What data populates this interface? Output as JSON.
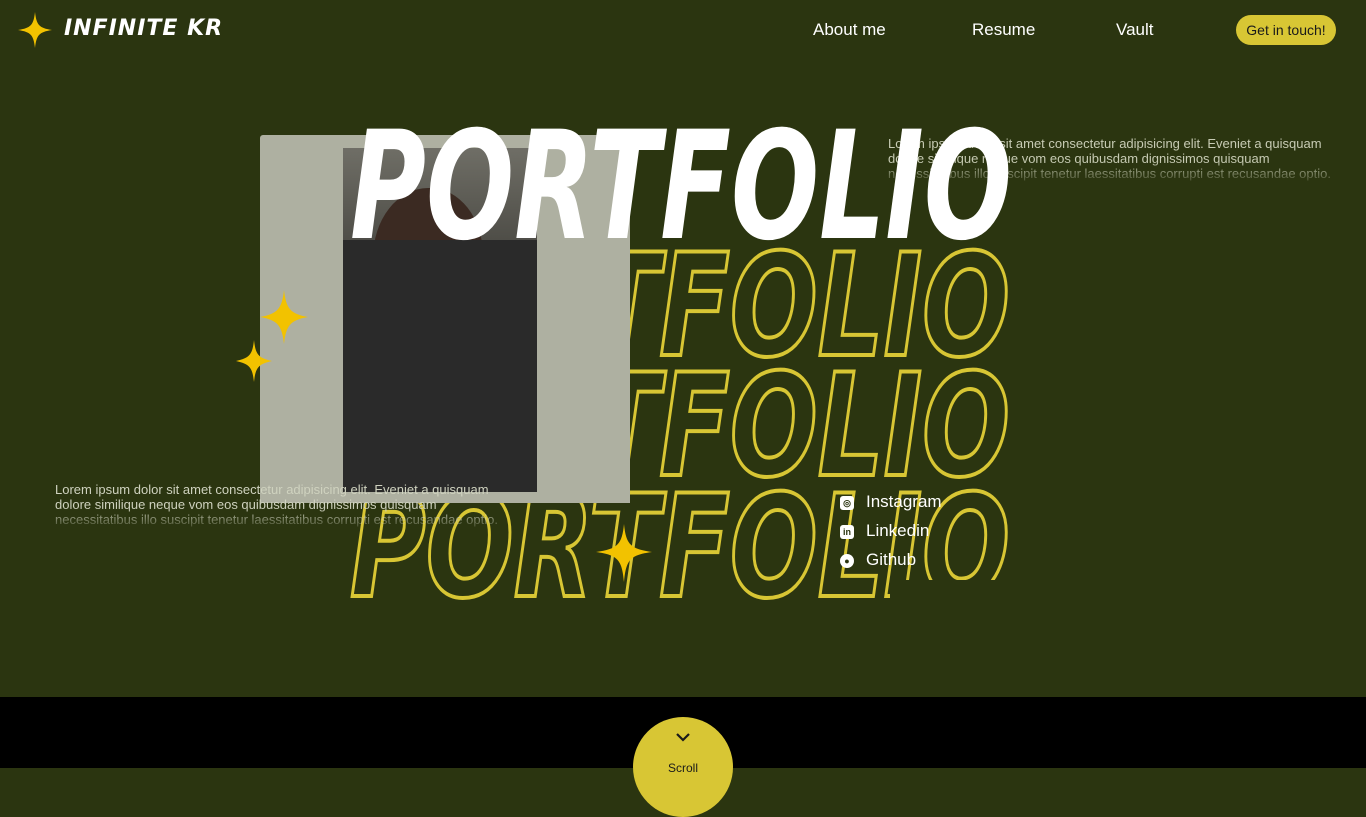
{
  "nav": {
    "brand": "INFINITE KR",
    "links": [
      "About me",
      "Resume",
      "Vault"
    ],
    "cta": "Get in touch!"
  },
  "hero": {
    "title": "PORTFOLIO",
    "outline_title": "PORTFOLIO",
    "paragraph": "Lorem ipsum dolor sit amet consectetur adipisicing elit. Eveniet a quisquam dolore similique neque vom eos quibusdam dignissimos quisquam necessitatibus illo suscipit tenetur laessitatibus corrupti est recusandae optio."
  },
  "social": [
    {
      "icon": "instagram-icon",
      "label": "Instagram"
    },
    {
      "icon": "linkedin-icon",
      "label": "Linkedin"
    },
    {
      "icon": "github-icon",
      "label": "Github"
    }
  ],
  "footer": {
    "scroll_label": "Scroll"
  },
  "colors": {
    "background": "#2b3510",
    "accent": "#d8c634",
    "footer": "#000000"
  }
}
